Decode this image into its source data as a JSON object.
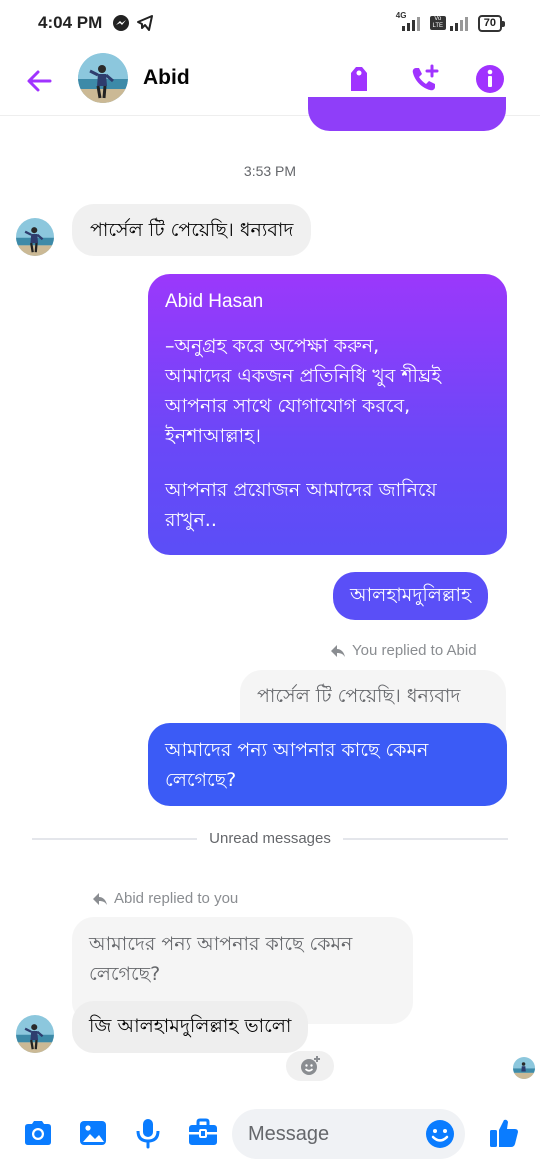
{
  "status_bar": {
    "time": "4:04 PM",
    "battery": "70",
    "network_1": "4G",
    "network_2": "Vo LTE"
  },
  "header": {
    "contact_name": "Abid"
  },
  "colors": {
    "accent": "#a033ff",
    "bubble_gradient_top": "#9b38fb",
    "bubble_gradient_bottom": "#3b5bf6",
    "incoming_bubble": "#f0f0f0"
  },
  "chat": {
    "timestamp": "3:53 PM",
    "msg_in_1": "পার্সেল টি পেয়েছি। ধন্যবাদ",
    "msg_out_long": {
      "line1": "Abid Hasan",
      "line2": "–অনুগ্রহ করে অপেক্ষা করুন,",
      "line3": "আমাদের একজন প্রতিনিধি খুব শীঘ্রই",
      "line4": "আপনার সাথে যোগাযোগ করবে,",
      "line5": "ইনশাআল্লাহ।",
      "line6": "আপনার প্রয়োজন আমাদের জানিয়ে",
      "line7": "রাখুন.."
    },
    "msg_out_2": "আলহামদুলিল্লাহ",
    "reply_note_out": "You replied to Abid",
    "quoted_out": "পার্সেল টি পেয়েছি। ধন্যবাদ",
    "msg_out_3": {
      "line1": "আমাদের পন্য আপনার কাছে কেমন",
      "line2": "লেগেছে?"
    },
    "unread_label": "Unread messages",
    "reply_note_in": "Abid replied to you",
    "quoted_in": {
      "line1": "আমাদের পন্য আপনার কাছে কেমন",
      "line2": "লেগেছে?"
    },
    "msg_in_2": "জি আলহামদুলিল্লাহ ভালো"
  },
  "composer": {
    "placeholder": "Message"
  },
  "icons": {
    "back": "arrow-left-icon",
    "tag": "tag-icon",
    "add_call": "add-call-icon",
    "info": "info-icon",
    "camera": "camera-icon",
    "gallery": "gallery-icon",
    "mic": "mic-icon",
    "briefcase": "briefcase-icon",
    "emoji": "emoji-icon",
    "like": "thumbs-up-icon"
  }
}
